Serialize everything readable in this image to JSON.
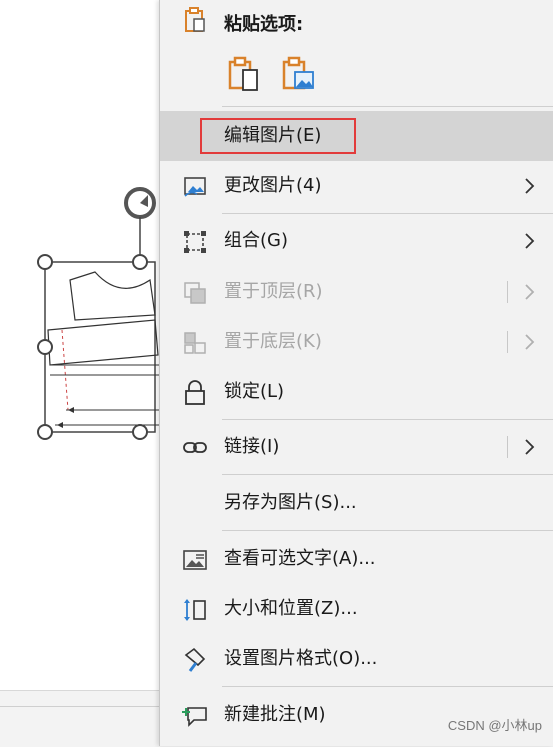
{
  "paste_options": {
    "title": "粘贴选项:",
    "options": [
      "paste-keep-source-icon",
      "paste-as-picture-icon"
    ]
  },
  "menu": {
    "edit_picture": "编辑图片(E)",
    "change_picture": "更改图片(4)",
    "group": "组合(G)",
    "bring_to_front": "置于顶层(R)",
    "send_to_back": "置于底层(K)",
    "lock": "锁定(L)",
    "link": "链接(I)",
    "save_as_picture": "另存为图片(S)...",
    "alt_text": "查看可选文字(A)...",
    "size_position": "大小和位置(Z)...",
    "format_picture": "设置图片格式(O)...",
    "new_comment": "新建批注(M)"
  },
  "watermark": "CSDN @小林up",
  "colors": {
    "accent": "#e23b3b",
    "icon_orange": "#d9822b",
    "icon_blue": "#2f7fd1",
    "highlight": "#d4d4d4"
  }
}
